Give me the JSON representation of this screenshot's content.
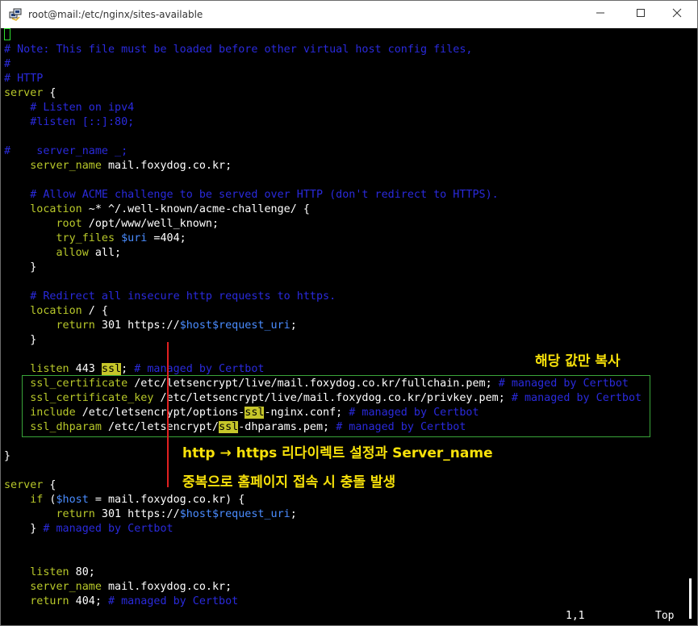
{
  "window": {
    "title": "root@mail:/etc/nginx/sites-available",
    "minimize_icon": "minimize-icon",
    "maximize_icon": "maximize-icon",
    "close_icon": "close-icon"
  },
  "editor": {
    "lines": {
      "l02": "# Note: This file must be loaded before other virtual host config files,",
      "l03": "#",
      "l04": "# HTTP",
      "l05a": "server",
      "l05b": " {",
      "l06": "    # Listen on ipv4",
      "l07": "    #listen [::]:80;",
      "l09": "#    server_name _;",
      "l10a": "    server_name",
      "l10b": " mail.foxydog.co.kr;",
      "l12": "    # Allow ACME challenge to be served over HTTP (don't redirect to HTTPS).",
      "l13a": "    location",
      "l13b": " ~* ^/.well-known/acme-challenge/ {",
      "l14a": "        root",
      "l14b": " /opt/www/well_known;",
      "l15a": "        try_files",
      "l15b": " ",
      "l15c": "$uri",
      "l15d": " =404;",
      "l16a": "        allow",
      "l16b": " all;",
      "l17": "    }",
      "l19": "    # Redirect all insecure http requests to https.",
      "l20a": "    location",
      "l20b": " / {",
      "l21a": "        return",
      "l21b": " 301 https://",
      "l21c": "$host$request_uri",
      "l21d": ";",
      "l22": "    }",
      "l24a": "    listen",
      "l24b": " 443 ",
      "l24c": "ssl",
      "l24d": "; ",
      "l24e": "# managed by Certbot",
      "l25a": "    ssl",
      "l25b": "_certificate",
      "l25c": " /etc/letsencrypt/live/mail.foxydog.co.kr/fullchain.pem; ",
      "l25d": "# managed by Certbot",
      "l26a": "    ssl",
      "l26b": "_certificate_key",
      "l26c": " /etc/letsencrypt/live/mail.foxydog.co.kr/privkey.pem; ",
      "l26d": "# managed by Certbot",
      "l27a": "    include",
      "l27b": " /etc/letsencrypt/options-",
      "l27c": "ssl",
      "l27d": "-nginx.conf; ",
      "l27e": "# managed by Certbot",
      "l28a": "    ssl",
      "l28b": "_dhparam",
      "l28c": " /etc/letsencrypt/",
      "l28d": "ssl",
      "l28e": "-dhparams.pem; ",
      "l28f": "# managed by Certbot",
      "l30": "}",
      "l32a": "server",
      "l32b": " {",
      "l33a": "    if",
      "l33b": " (",
      "l33c": "$host",
      "l33d": " = mail.foxydog.co.kr) {",
      "l34a": "        return",
      "l34b": " 301 https://",
      "l34c": "$host$request_uri",
      "l34d": ";",
      "l35a": "    }",
      "l35b": " # managed by Certbot",
      "l38a": "    listen",
      "l38b": " 80;",
      "l39a": "    server_name",
      "l39b": " mail.foxydog.co.kr;",
      "l40a": "    return",
      "l40b": " 404; ",
      "l40c": "# managed by Certbot"
    },
    "status": {
      "position": "1,1",
      "scroll": "Top"
    }
  },
  "annotations": {
    "copy_note": "해당 값만 복사",
    "conflict_line1": "http → https 리다이렉트 설정과 Server_name",
    "conflict_line2": "중복으로 홈페이지 접속 시 충돌 발생"
  },
  "colors": {
    "background": "#000000",
    "comment": "#2a2adc",
    "keyword": "#b8c82a",
    "variable": "#4a8cff",
    "highlight": "#c6c62a",
    "annotation_text": "#f7e10a",
    "annotation_box": "#3aa53a",
    "annotation_line": "#e02020",
    "cursor": "#2ee02e"
  }
}
